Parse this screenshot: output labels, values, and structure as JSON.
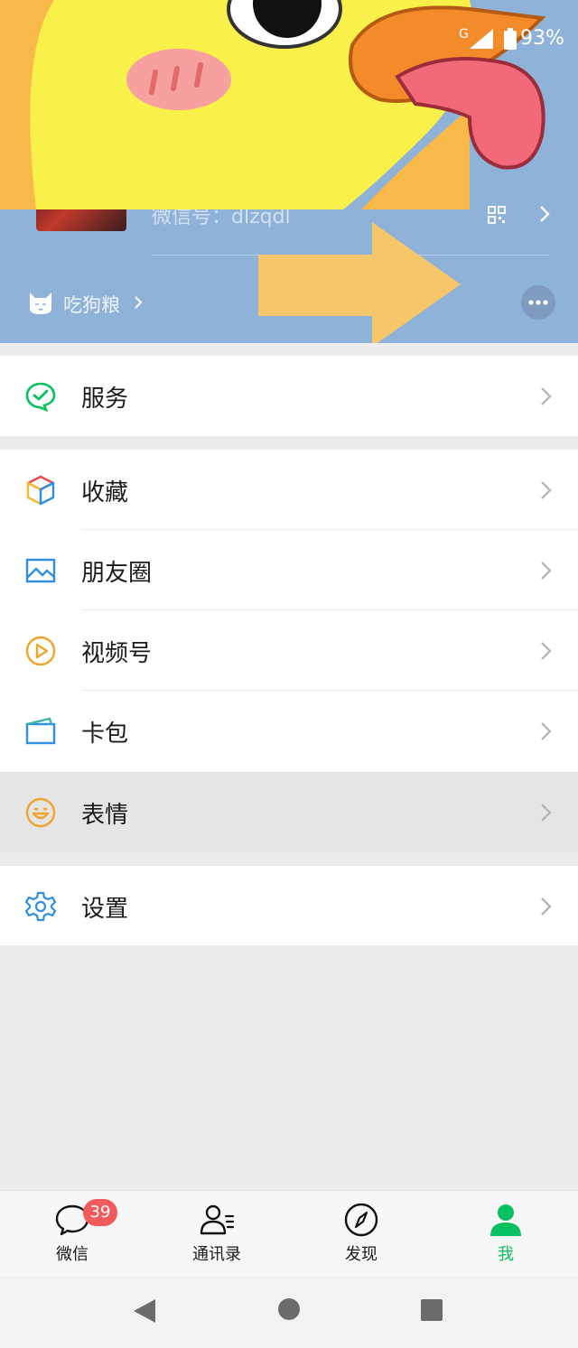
{
  "status_bar": {
    "battery": "93%",
    "network": "G"
  },
  "profile": {
    "wechat_id": "微信号：dlzqdl",
    "status_text": "吃狗粮"
  },
  "menu": {
    "service": "服务",
    "favorites": "收藏",
    "moments": "朋友圈",
    "channels": "视频号",
    "cards": "卡包",
    "stickers": "表情",
    "settings": "设置"
  },
  "tabs": {
    "chats": "微信",
    "chats_badge": "39",
    "contacts": "通讯录",
    "discover": "发现",
    "me": "我"
  },
  "colors": {
    "header_bg": "#8fb2d8",
    "accent_green": "#07c160",
    "badge_red": "#f25b5b",
    "highlight_row": "#e5e5e5",
    "arrow_overlay": "#f5c76a"
  },
  "icons": {
    "service": "wechat-pay-icon",
    "favorites": "cube-icon",
    "moments": "landscape-icon",
    "channels": "play-icon",
    "cards": "wallet-icon",
    "stickers": "smiley-icon",
    "settings": "gear-icon"
  }
}
